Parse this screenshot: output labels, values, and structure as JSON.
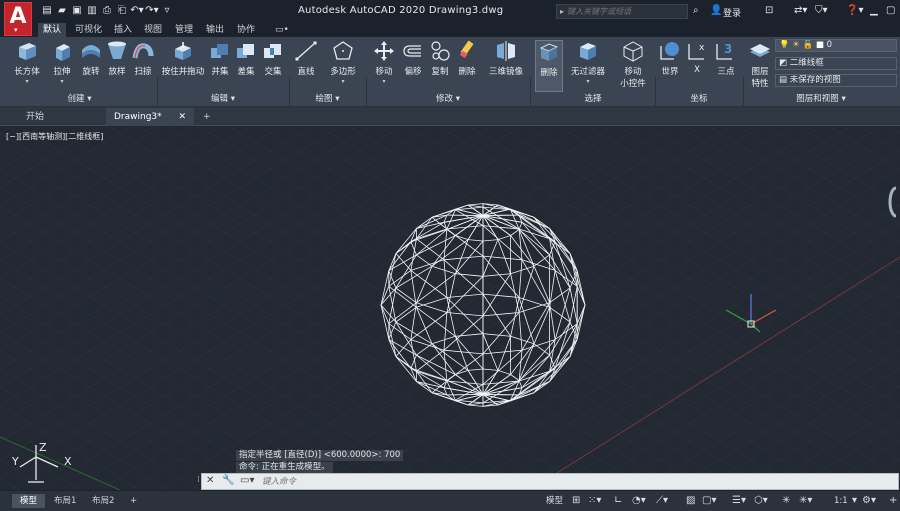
{
  "title_bar": {
    "app_logo": "A",
    "title": "Autodesk AutoCAD 2020    Drawing3.dwg",
    "search_placeholder": "键入关键字或短语",
    "login": "登录",
    "icons": [
      "new-icon",
      "open-icon",
      "save-icon",
      "saveas-icon",
      "publish-icon",
      "print-icon",
      "undo-icon",
      "redo-icon",
      "qat-dropdown-icon"
    ]
  },
  "ribbon_tabs": [
    "默认",
    "可视化",
    "插入",
    "视图",
    "管理",
    "输出",
    "协作"
  ],
  "ribbon_tab_extra": "▭•",
  "ribbon": {
    "tools": [
      {
        "label": "长方体",
        "dd": "▾"
      },
      {
        "label": "拉伸",
        "dd": "▾"
      },
      {
        "label": "旋转",
        "dd": ""
      },
      {
        "label": "放样",
        "dd": ""
      },
      {
        "label": "扫掠",
        "dd": ""
      },
      {
        "label": "按住并拖动",
        "dd": ""
      },
      {
        "label": "并集",
        "dd": ""
      },
      {
        "label": "差集",
        "dd": ""
      },
      {
        "label": "交集",
        "dd": ""
      },
      {
        "label": "直线",
        "dd": ""
      },
      {
        "label": "多边形",
        "dd": "▾"
      },
      {
        "label": "移动",
        "dd": "▾"
      },
      {
        "label": "偏移",
        "dd": ""
      },
      {
        "label": "复制",
        "dd": ""
      },
      {
        "label": "删除",
        "dd": ""
      },
      {
        "label": "三维镜像",
        "dd": ""
      },
      {
        "label": "删除",
        "dd": ""
      },
      {
        "label": "无过滤器",
        "dd": "▾"
      },
      {
        "label": "移动",
        "label2": "小控件",
        "dd": "▾"
      },
      {
        "label": "世界",
        "dd": ""
      },
      {
        "label": "X",
        "dd": ""
      },
      {
        "label": "三点",
        "dd": ""
      },
      {
        "label": "图层",
        "label2": "特性",
        "dd": ""
      }
    ],
    "panels": [
      "创建 ▾",
      "编辑 ▾",
      "绘图 ▾",
      "修改 ▾",
      "选择",
      "坐标",
      "图层和视图 ▾"
    ],
    "layer_value": "0",
    "visual_style": "二维线框",
    "saved_view": "未保存的视图"
  },
  "doc_tabs": [
    {
      "label": "开始"
    },
    {
      "label": "Drawing3*"
    }
  ],
  "viewport_label": "[−][西南等轴测][二维线框]",
  "ucs": {
    "x": "X",
    "y": "Y",
    "z": "Z"
  },
  "command": {
    "history": [
      "指定半径或 [直径(D)] <600.0000>: 700",
      "命令:  正在重生成模型。"
    ],
    "placeholder": "键入命令"
  },
  "layouts": [
    "模型",
    "布局1",
    "布局2"
  ],
  "status": {
    "model": "模型",
    "scale": "1:1"
  },
  "colors": {
    "bg": "#222933",
    "ribbon": "#3b4452",
    "titlebar": "#1c222b",
    "wire": "#ffffff",
    "axis_red": "#a83a3a",
    "axis_green": "#3aa03a"
  }
}
